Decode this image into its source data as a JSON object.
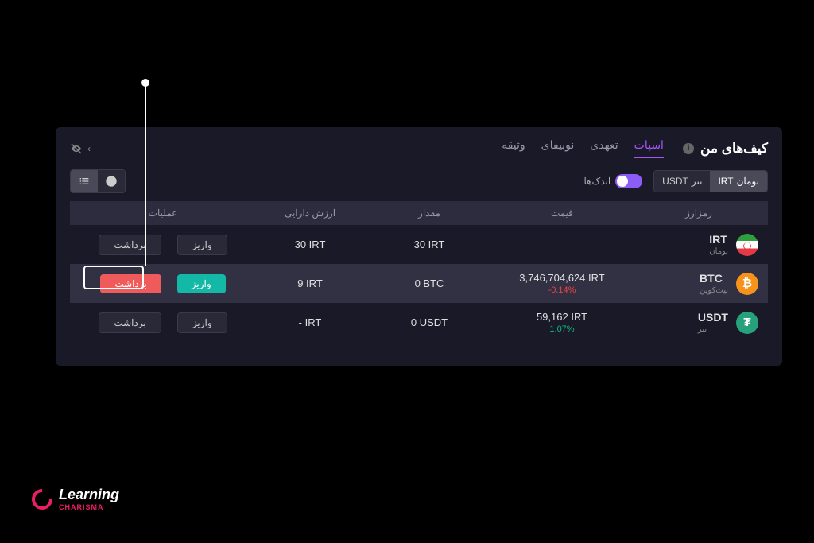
{
  "header": {
    "title": "کیف‌های من",
    "tabs": [
      "اسپات",
      "تعهدی",
      "نوبیفای",
      "وثیقه"
    ],
    "active_tab_index": 0
  },
  "controls": {
    "currency_options": [
      {
        "label": "تومان",
        "code": "IRT"
      },
      {
        "label": "تتر",
        "code": "USDT"
      }
    ],
    "currency_active_index": 0,
    "small_toggle_label": "اندک‌ها"
  },
  "columns": {
    "crypto": "رمزارز",
    "price": "قیمت",
    "amount": "مقدار",
    "value": "ارزش دارایی",
    "actions": "عملیات"
  },
  "rows": [
    {
      "symbol": "IRT",
      "name": "تومان",
      "coin_class": "irt",
      "price": "",
      "change": "",
      "change_dir": "",
      "amount": "30 IRT",
      "value": "30 IRT",
      "highlighted": false,
      "deposit_style": "normal",
      "withdraw_style": "normal"
    },
    {
      "symbol": "BTC",
      "name": "بیت‌کوین",
      "coin_class": "btc",
      "price": "3,746,704,624 IRT",
      "change": "-0.14%",
      "change_dir": "down",
      "amount": "0 BTC",
      "value": "9 IRT",
      "highlighted": true,
      "deposit_style": "teal",
      "withdraw_style": "red"
    },
    {
      "symbol": "USDT",
      "name": "تتر",
      "coin_class": "usdt",
      "price": "59,162 IRT",
      "change": "1.07%",
      "change_dir": "up",
      "amount": "0 USDT",
      "value": "- IRT",
      "highlighted": false,
      "deposit_style": "normal",
      "withdraw_style": "normal"
    }
  ],
  "buttons": {
    "deposit": "واریز",
    "withdraw": "برداشت"
  },
  "logo": {
    "main": "Learning",
    "sub": "CHARISMA"
  }
}
